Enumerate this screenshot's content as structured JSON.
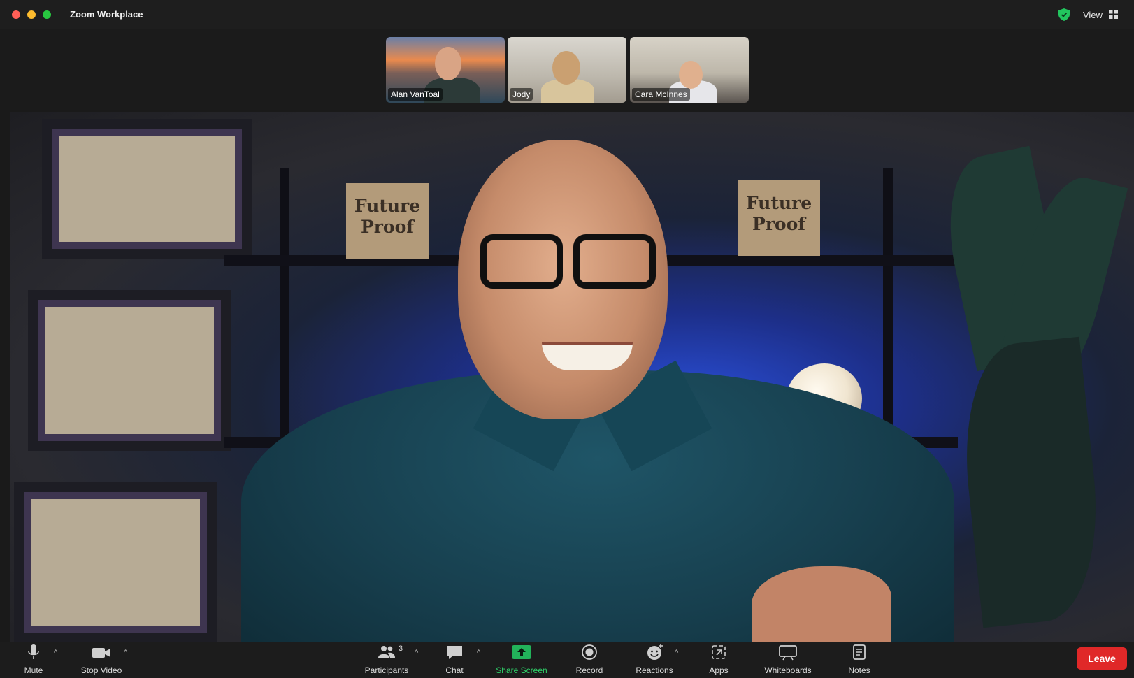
{
  "window": {
    "title": "Zoom Workplace",
    "view_label": "View"
  },
  "gallery": {
    "participants": [
      {
        "name": "Alan VanToal"
      },
      {
        "name": "Jody"
      },
      {
        "name": "Cara McInnes"
      }
    ]
  },
  "main_video": {
    "signs": [
      "Future Proof",
      "Future Proof"
    ]
  },
  "toolbar": {
    "mute": "Mute",
    "stop_video": "Stop Video",
    "participants": "Participants",
    "participant_count": "3",
    "chat": "Chat",
    "share_screen": "Share Screen",
    "record": "Record",
    "reactions": "Reactions",
    "apps": "Apps",
    "whiteboards": "Whiteboards",
    "notes": "Notes",
    "leave": "Leave"
  },
  "colors": {
    "leave": "#e02828",
    "share_green": "#2fd36a",
    "shield_green": "#22c55e"
  }
}
